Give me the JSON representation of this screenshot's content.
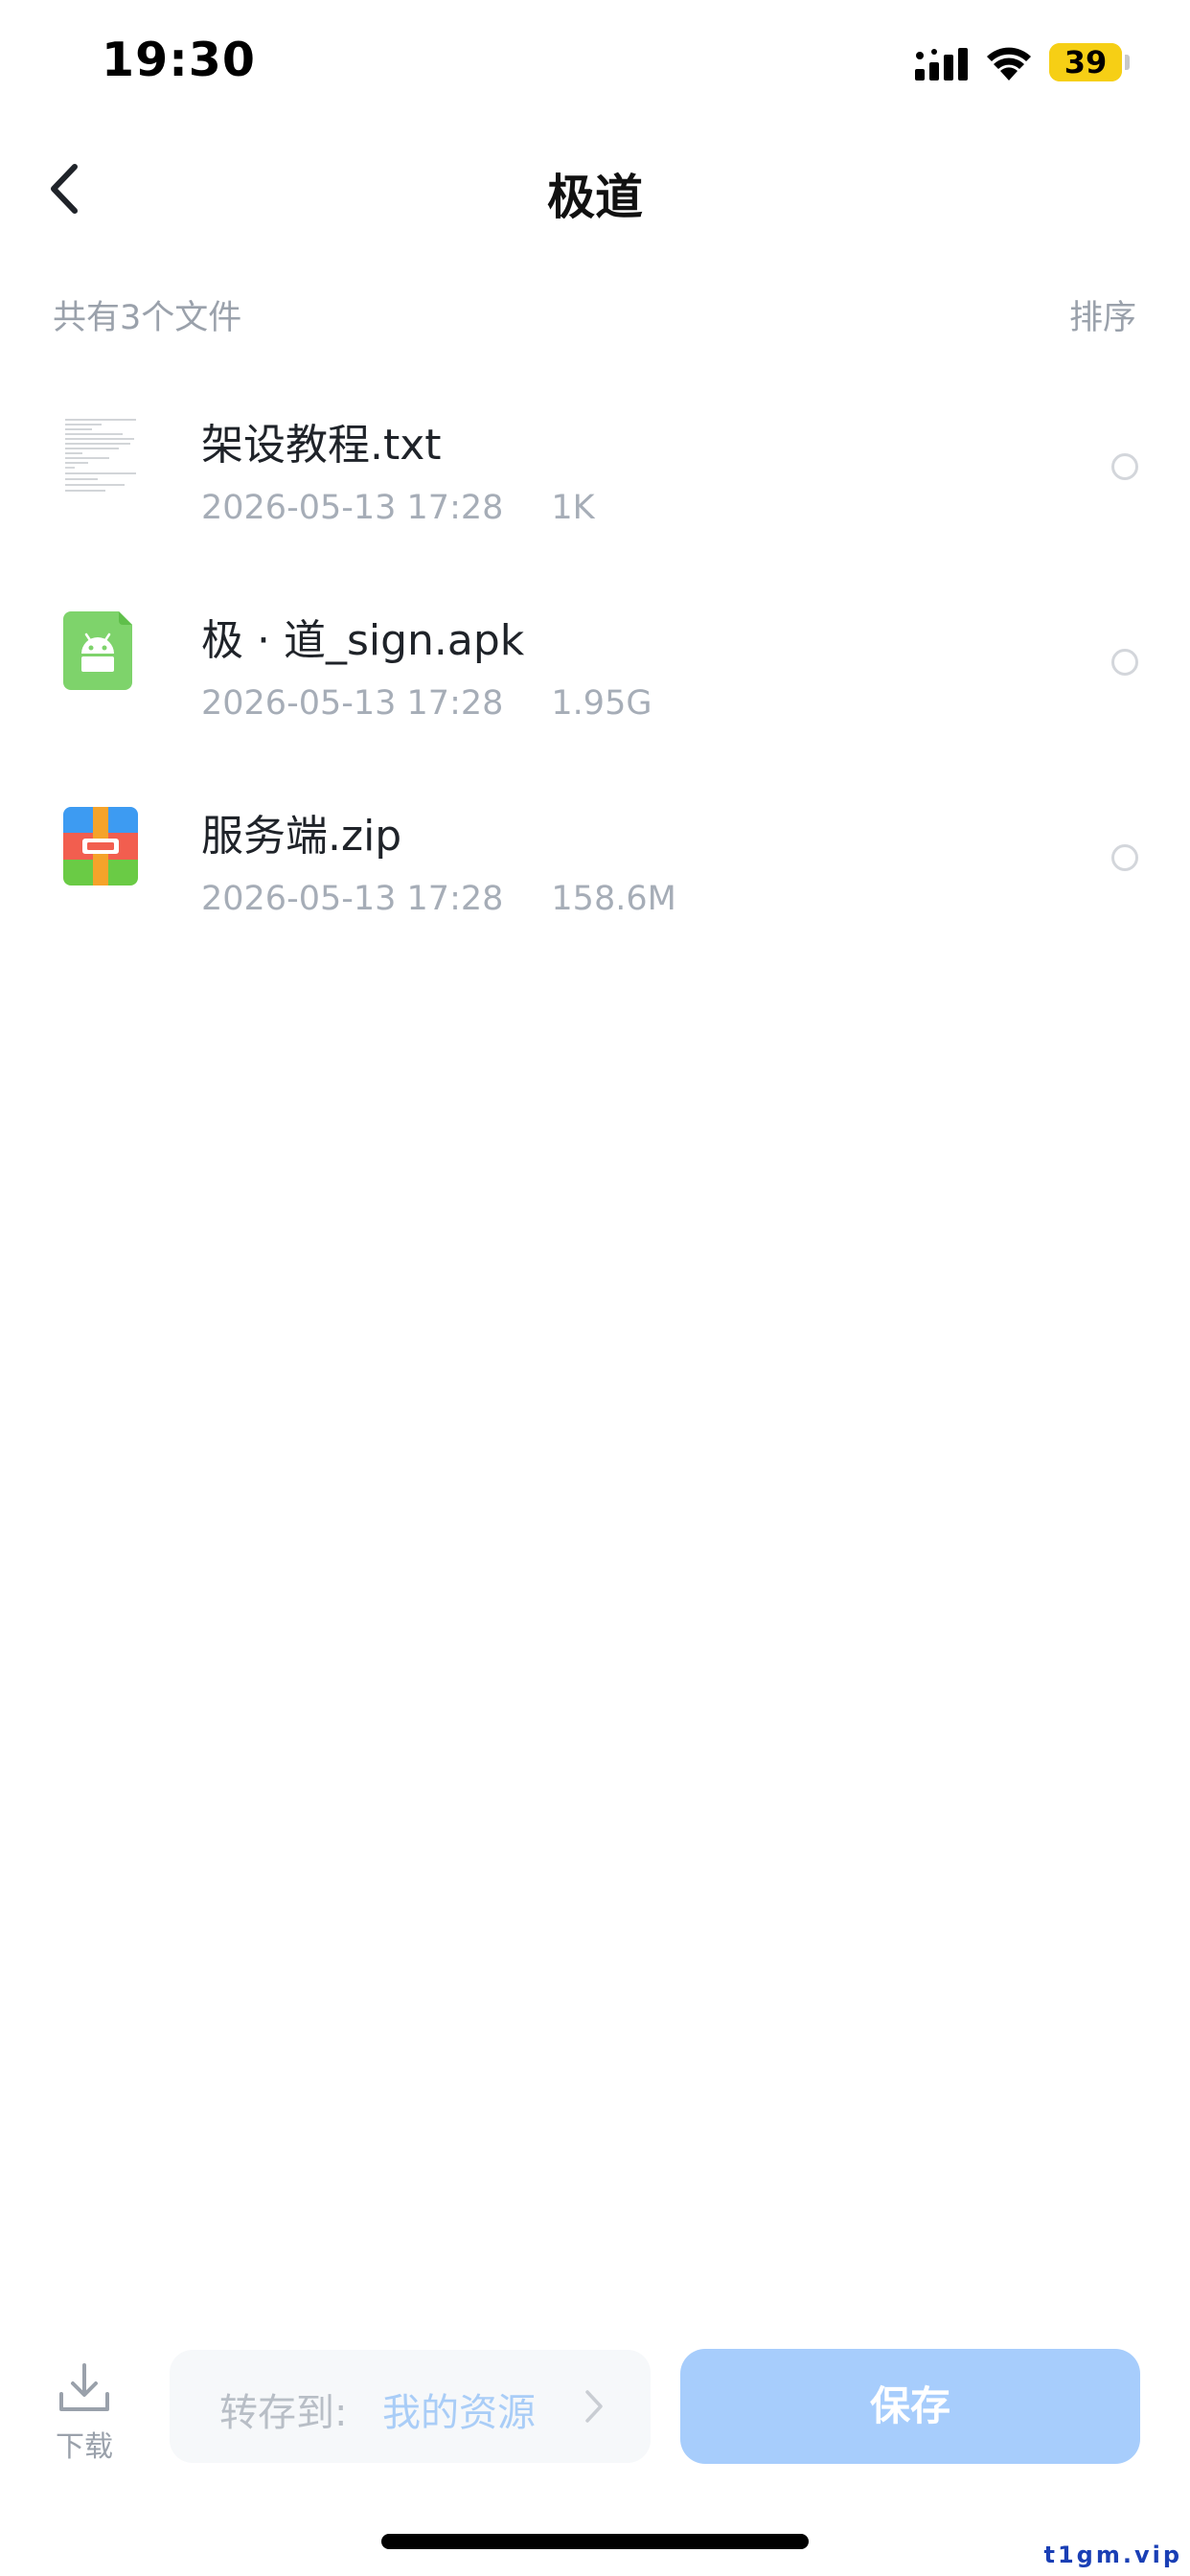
{
  "status_bar": {
    "time": "19:30",
    "battery": "39",
    "battery_level": 0.39,
    "icons": [
      "signal-icon",
      "wifi-icon",
      "battery-icon"
    ]
  },
  "nav": {
    "title": "极道",
    "back_icon": "chevron-left-icon"
  },
  "list_header": {
    "count_text": "共有3个文件",
    "sort_label": "排序"
  },
  "files": [
    {
      "name": "架设教程.txt",
      "date": "2026-05-13 17:28",
      "size": "1K",
      "icon": "text-document-icon"
    },
    {
      "name": "极 · 道_sign.apk",
      "date": "2026-05-13 17:28",
      "size": "1.95G",
      "icon": "android-apk-icon"
    },
    {
      "name": "服务端.zip",
      "date": "2026-05-13 17:28",
      "size": "158.6M",
      "icon": "zip-archive-icon"
    }
  ],
  "bottom_bar": {
    "download_label": "下载",
    "save_to_label": "转存到:",
    "save_to_target": "我的资源",
    "save_button": "保存"
  },
  "watermark": "t1gm.vip",
  "colors": {
    "accent_disabled": "#a7cdfc",
    "muted_text": "#9aa1ab",
    "battery_yellow": "#f6cf15"
  }
}
